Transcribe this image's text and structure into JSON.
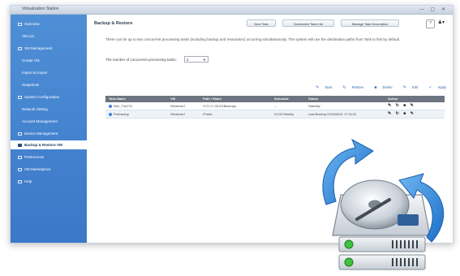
{
  "window": {
    "title": "Virtualization Station"
  },
  "sidebar": {
    "items": [
      {
        "label": "Overview"
      },
      {
        "label": "VM List"
      },
      {
        "label": "VM Management"
      },
      {
        "label": "Create VM"
      },
      {
        "label": "Import & Export"
      },
      {
        "label": "Snapshots"
      },
      {
        "label": "System Configuration"
      },
      {
        "label": "Network Setting"
      },
      {
        "label": "Account Management"
      },
      {
        "label": "Device Management"
      },
      {
        "label": "Backup & Restore VM"
      },
      {
        "label": "Preferences"
      },
      {
        "label": "VM Marketplace"
      },
      {
        "label": "Help"
      }
    ]
  },
  "main": {
    "heading": "Backup & Restore",
    "toolbar": {
      "new_task": "New Task",
      "schedule": "Scheduled Task Info",
      "manage": "Manage Task Description"
    },
    "description": "There can be up to two concurrent processing tasks (including backup and restoration) occurring simultaneously. The system will use the destination paths from Task to this by default.",
    "concurrent_label": "The number of concurrent processing tasks:",
    "concurrent_value": "2",
    "actions": [
      "Start",
      "Restore",
      "Delete",
      "Edit",
      "Apply"
    ],
    "table": {
      "columns": [
        "Task Name",
        "VM",
        "Path / Share",
        "Schedule",
        "Status",
        "Action"
      ],
      "rows": [
        {
          "name": "Win_7Vp1Tk",
          "vm": "Windows7",
          "path": "\\172.17.28.31\\Backups",
          "schedule": "--",
          "status": "Standby"
        },
        {
          "name": "Probackup",
          "vm": "Windows7",
          "path": "/Public",
          "schedule": "01:00 Weekly",
          "status": "Last Backup:2015/08/11 17:31:51"
        }
      ]
    }
  }
}
